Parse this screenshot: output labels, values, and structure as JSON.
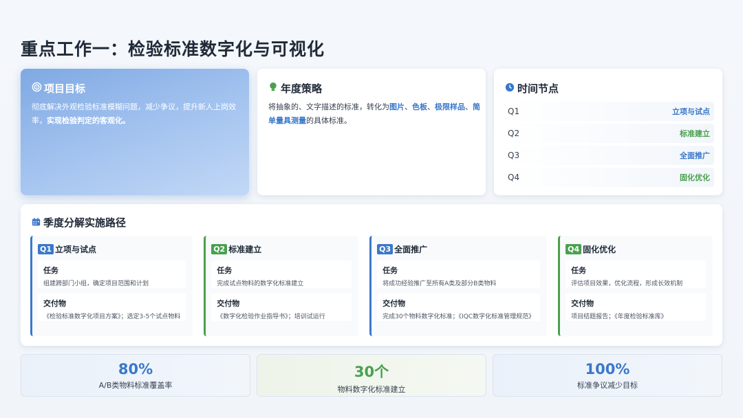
{
  "page_title": "重点工作一：检验标准数字化与可视化",
  "goal": {
    "heading": "项目目标",
    "text_a": "彻底解决外观检验标准模糊问题，减少争议，提升新人上岗效率，",
    "text_b": "实现检验判定的客观化。"
  },
  "strategy": {
    "heading": "年度策略",
    "t1": "将抽象的、文字描述的标准，转化为",
    "h1": "图片",
    "s1": "、",
    "h2": "色板",
    "s2": "、",
    "h3": "极限样品",
    "s3": "、",
    "h4": "简单量具测量",
    "t2": "的具体标准。"
  },
  "timeline": {
    "heading": "时间节点",
    "rows": [
      {
        "q": "Q1",
        "v": "立项与试点",
        "color": "#3a78c9"
      },
      {
        "q": "Q2",
        "v": "标准建立",
        "color": "#4aa04f"
      },
      {
        "q": "Q3",
        "v": "全面推广",
        "color": "#3a78c9"
      },
      {
        "q": "Q4",
        "v": "固化优化",
        "color": "#4aa04f"
      }
    ]
  },
  "roadmap": {
    "heading": "季度分解实施路径",
    "task_label": "任务",
    "deliverable_label": "交付物",
    "quarters": [
      {
        "badge": "Q1",
        "title": "立项与试点",
        "task": "组建跨部门小组，确定项目范围和计划",
        "deliverable": "《检验标准数字化项目方案》；选定3-5个试点物料"
      },
      {
        "badge": "Q2",
        "title": "标准建立",
        "task": "完成试点物料的数字化标准建立",
        "deliverable": "《数字化检验作业指导书》；培训试运行"
      },
      {
        "badge": "Q3",
        "title": "全面推广",
        "task": "将成功经验推广至所有A类及部分B类物料",
        "deliverable": "完成30个物料数字化标准；《IQC数字化标准管理规范》"
      },
      {
        "badge": "Q4",
        "title": "固化优化",
        "task": "评估项目效果，优化流程，形成长效机制",
        "deliverable": "项目结题报告；《年度检验标准库》"
      }
    ]
  },
  "kpis": [
    {
      "value": "80%",
      "label": "A/B类物料标准覆盖率",
      "color": "#3a78c9"
    },
    {
      "value": "30个",
      "label": "物料数字化标准建立",
      "color": "#4aa04f"
    },
    {
      "value": "100%",
      "label": "标准争议减少目标",
      "color": "#3a78c9"
    }
  ]
}
